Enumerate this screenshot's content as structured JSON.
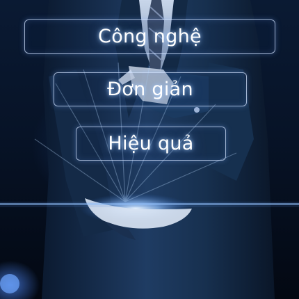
{
  "labels": [
    {
      "text": "Công nghệ"
    },
    {
      "text": "Đơn giản"
    },
    {
      "text": "Hiệu quả"
    }
  ],
  "colors": {
    "background": "#071327",
    "suit": "#1b3558",
    "glow": "#8fc4ff",
    "label_text": "#ffffff",
    "box_border": "#d2e1ff"
  }
}
